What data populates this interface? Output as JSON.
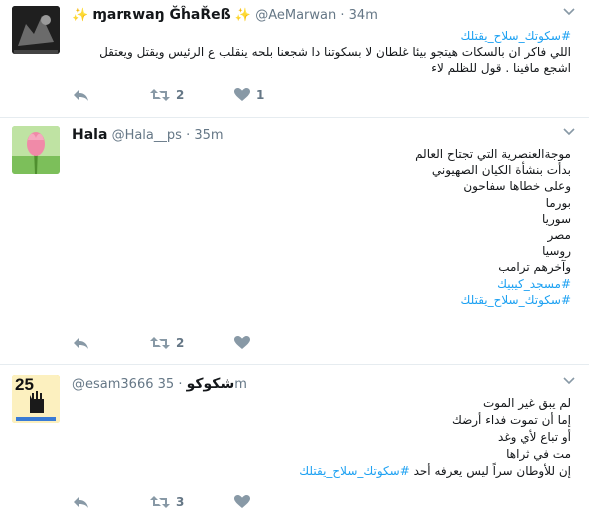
{
  "tweets": [
    {
      "name": "ɱarʀwaŋ ĞĥaŘeß",
      "sparkle_left": "✨",
      "sparkle_right": "✨",
      "handle": "@AeMarwan",
      "sep": "·",
      "time": "34m",
      "hashtag_top": "#سكوتك_سلاح_يقتلك",
      "lines": [
        "اللي فاكر ان بالسكات هيتجو بيئا غلطان لا بسكوتنا دا شجعنا بلحه ينقلب ع الرئيس ويقتل ويعتقل اشجع مافينا . قول للظلم لاء"
      ],
      "retweets": "2",
      "likes": "1",
      "avatar_icon": "dark-silhouette-avatar",
      "colors": {
        "avatar_bg": "#2b2b2b"
      }
    },
    {
      "name": "Hala",
      "handle": "@Hala__ps",
      "sep": "·",
      "time": "35m",
      "lines": [
        "موجةالعنصرية التي تجتاح العالم",
        "بدأت بنشأة الكيان الصهيوني",
        "وعلى خطاها سفاحون",
        "بورما",
        "سوريا",
        "مصر",
        "روسيا",
        "وآخرهم ترامب"
      ],
      "hashtags_bottom": [
        "#مسجد_كيبيك",
        "#سكوتك_سلاح_يقتلك"
      ],
      "retweets": "2",
      "likes": "",
      "avatar_icon": "pink-tulip-avatar",
      "colors": {
        "avatar_bg": "#a8d68a"
      }
    },
    {
      "name": "شكوكو",
      "handle": "@esam3666",
      "sep": "·",
      "time": "35m",
      "lines": [
        "لم يبق غير الموت",
        "إما أن تموت فداء أرضك",
        "أو تباع لأي وغد",
        "مت في ثراها"
      ],
      "last_line_text": "إن للأوطان سراً ليس يعرفه أحد",
      "last_line_hashtag": "#سكوتك_سلاح_يقتلك",
      "retweets": "3",
      "likes": "",
      "avatar_icon": "rabaa-25-avatar",
      "avatar_text": "25",
      "colors": {
        "avatar_bg": "#f5c400"
      }
    }
  ],
  "colors": {
    "link": "#1da1f2",
    "muted": "#657786",
    "icon": "#8899a6",
    "border": "#e6ecf0"
  }
}
